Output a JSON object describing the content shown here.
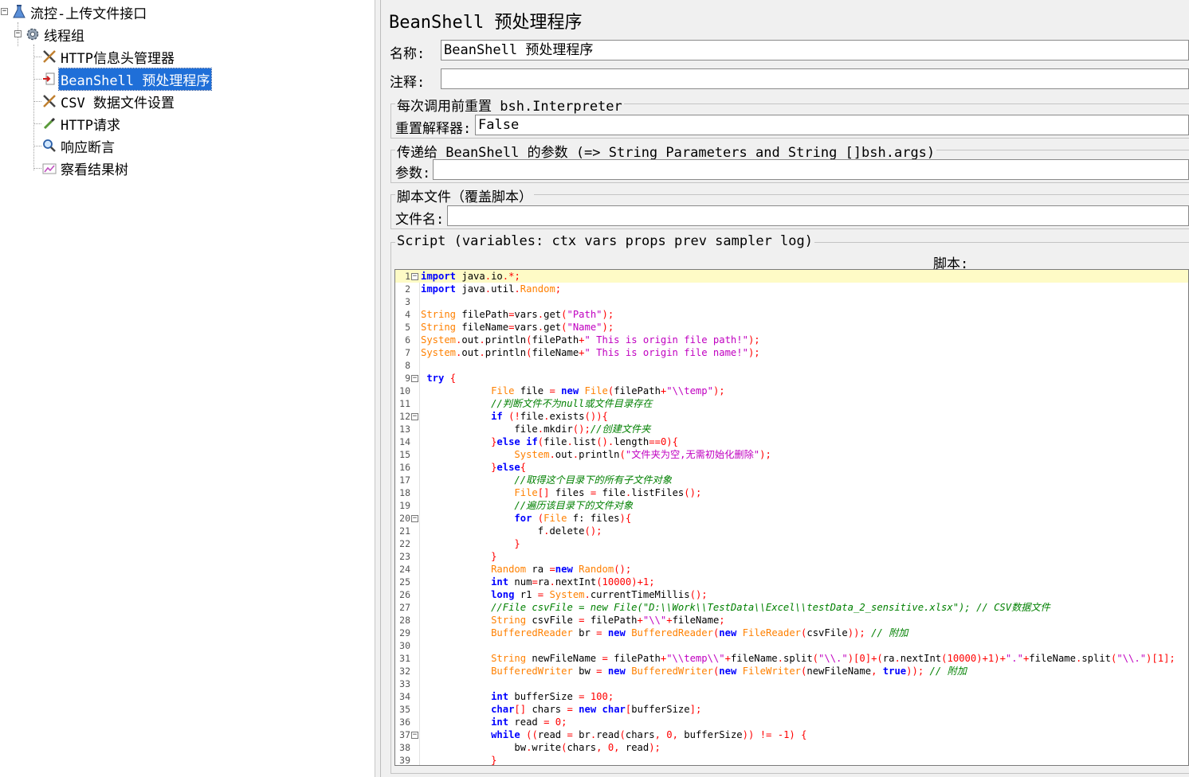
{
  "tree": {
    "root": "流控-上传文件接口",
    "thread_group": "线程组",
    "items": [
      {
        "label": "HTTP信息头管理器",
        "icon": "tools-icon",
        "selected": false
      },
      {
        "label": "BeanShell 预处理程序",
        "icon": "preprocessor-icon",
        "selected": true
      },
      {
        "label": "CSV 数据文件设置",
        "icon": "tools-icon",
        "selected": false
      },
      {
        "label": "HTTP请求",
        "icon": "pipette-icon",
        "selected": false
      },
      {
        "label": "响应断言",
        "icon": "magnifier-icon",
        "selected": false
      },
      {
        "label": "察看结果树",
        "icon": "chart-icon",
        "selected": false
      }
    ]
  },
  "panel": {
    "title": "BeanShell 预处理程序",
    "name_label": "名称:",
    "name_value": "BeanShell 预处理程序",
    "comment_label": "注释:",
    "comment_value": "",
    "reset_group_title": "每次调用前重置 bsh.Interpreter",
    "reset_label": "重置解释器:",
    "reset_value": "False",
    "params_group_title": "传递给 BeanShell 的参数 (=> String Parameters and String []bsh.args)",
    "params_label": "参数:",
    "params_value": "",
    "file_group_title": "脚本文件（覆盖脚本）",
    "file_label": "文件名:",
    "file_value": "",
    "script_group_title": "Script (variables: ctx vars props prev sampler log)",
    "script_label": "脚本:"
  },
  "code_lines": [
    {
      "n": "1",
      "fold": true,
      "text": "import java.io.*;"
    },
    {
      "n": "2",
      "fold": false,
      "text": "import java.util.Random;"
    },
    {
      "n": "3",
      "fold": false,
      "text": ""
    },
    {
      "n": "4",
      "fold": false,
      "text": "String filePath=vars.get(\"Path\");"
    },
    {
      "n": "5",
      "fold": false,
      "text": "String fileName=vars.get(\"Name\");"
    },
    {
      "n": "6",
      "fold": false,
      "text": "System.out.println(filePath+\" This is origin file path!\");"
    },
    {
      "n": "7",
      "fold": false,
      "text": "System.out.println(fileName+\" This is origin file name!\");"
    },
    {
      "n": "8",
      "fold": false,
      "text": ""
    },
    {
      "n": "9",
      "fold": true,
      "text": " try {"
    },
    {
      "n": "10",
      "fold": false,
      "text": "            File file = new File(filePath+\"\\\\temp\");"
    },
    {
      "n": "11",
      "fold": false,
      "text": "            //判断文件不为null或文件目录存在"
    },
    {
      "n": "12",
      "fold": true,
      "text": "            if (!file.exists()){"
    },
    {
      "n": "13",
      "fold": false,
      "text": "                file.mkdir();//创建文件夹"
    },
    {
      "n": "14",
      "fold": false,
      "text": "            }else if(file.list().length==0){"
    },
    {
      "n": "15",
      "fold": false,
      "text": "                System.out.println(\"文件夹为空,无需初始化删除\");"
    },
    {
      "n": "16",
      "fold": false,
      "text": "            }else{"
    },
    {
      "n": "17",
      "fold": false,
      "text": "                //取得这个目录下的所有子文件对象"
    },
    {
      "n": "18",
      "fold": false,
      "text": "                File[] files = file.listFiles();"
    },
    {
      "n": "19",
      "fold": false,
      "text": "                //遍历该目录下的文件对象"
    },
    {
      "n": "20",
      "fold": true,
      "text": "                for (File f: files){"
    },
    {
      "n": "21",
      "fold": false,
      "text": "                    f.delete();"
    },
    {
      "n": "22",
      "fold": false,
      "text": "                }"
    },
    {
      "n": "23",
      "fold": false,
      "text": "            }"
    },
    {
      "n": "24",
      "fold": false,
      "text": "            Random ra =new Random();"
    },
    {
      "n": "25",
      "fold": false,
      "text": "            int num=ra.nextInt(10000)+1;"
    },
    {
      "n": "26",
      "fold": false,
      "text": "            long r1 = System.currentTimeMillis();"
    },
    {
      "n": "27",
      "fold": false,
      "text": "            //File csvFile = new File(\"D:\\\\Work\\\\TestData\\\\Excel\\\\testData_2_sensitive.xlsx\"); // CSV数据文件"
    },
    {
      "n": "28",
      "fold": false,
      "text": "            String csvFile = filePath+\"\\\\\"+fileName;"
    },
    {
      "n": "29",
      "fold": false,
      "text": "            BufferedReader br = new BufferedReader(new FileReader(csvFile)); // 附加"
    },
    {
      "n": "30",
      "fold": false,
      "text": ""
    },
    {
      "n": "31",
      "fold": false,
      "text": "            String newFileName = filePath+\"\\\\temp\\\\\"+fileName.split(\"\\\\.\")[0]+(ra.nextInt(10000)+1)+\".\"+fileName.split(\"\\\\.\")[1];"
    },
    {
      "n": "32",
      "fold": false,
      "text": "            BufferedWriter bw = new BufferedWriter(new FileWriter(newFileName, true)); // 附加"
    },
    {
      "n": "33",
      "fold": false,
      "text": ""
    },
    {
      "n": "34",
      "fold": false,
      "text": "            int bufferSize = 100;"
    },
    {
      "n": "35",
      "fold": false,
      "text": "            char[] chars = new char[bufferSize];"
    },
    {
      "n": "36",
      "fold": false,
      "text": "            int read = 0;"
    },
    {
      "n": "37",
      "fold": true,
      "text": "            while ((read = br.read(chars, 0, bufferSize)) != -1) {"
    },
    {
      "n": "38",
      "fold": false,
      "text": "                bw.write(chars, 0, read);"
    },
    {
      "n": "39",
      "fold": false,
      "text": "            }"
    }
  ],
  "colors": {
    "keyword": "#0000ff",
    "type": "#ff8000",
    "string": "#c000c0",
    "number": "#ff0000",
    "comment": "#008000",
    "active_line": "#fefbc6",
    "selection": "#1f6fd8"
  }
}
